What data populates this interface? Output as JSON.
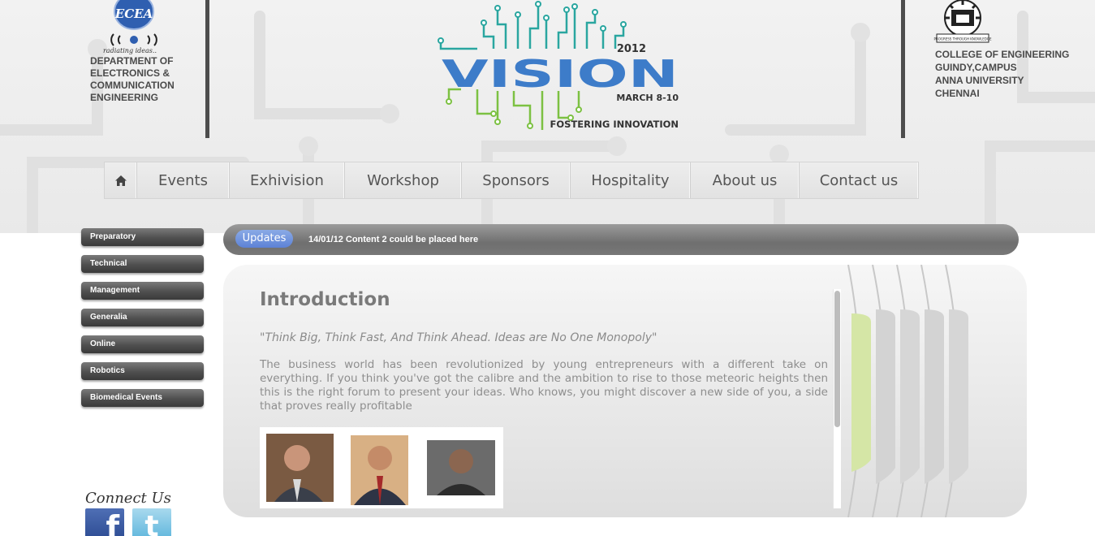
{
  "department": {
    "logo_text": "ECEA",
    "tagline": "radiating ideas..",
    "name_lines": [
      "DEPARTMENT OF",
      "ELECTRONICS &",
      "COMMUNICATION",
      "ENGINEERING"
    ]
  },
  "event_logo": {
    "year": "2012",
    "title": "VISION",
    "dates": "MARCH 8-10",
    "tagline": "FOSTERING INNOVATION"
  },
  "college": {
    "emblem_motto": "PROGRESS THROUGH KNOWLEDGE",
    "name_lines": [
      "COLLEGE OF ENGINEERING",
      "GUINDY,CAMPUS",
      "ANNA UNIVERSITY",
      "CHENNAI"
    ]
  },
  "nav": {
    "home_icon": "home-icon",
    "items": [
      "Events",
      "Exhivision",
      "Workshop",
      "Sponsors",
      "Hospitality",
      "About us",
      "Contact us"
    ]
  },
  "sidebar": {
    "items": [
      "Preparatory",
      "Technical",
      "Management",
      "Generalia",
      "Online",
      "Robotics",
      "Biomedical Events"
    ]
  },
  "updates": {
    "label": "Updates",
    "date": "14/01/12",
    "text": "Content 2 could be placed here"
  },
  "intro": {
    "title": "Introduction",
    "quote": "\"Think Big, Think Fast, And Think Ahead. Ideas are No One Monopoly\"",
    "body": "The business world has been revolutionized by young entrepreneurs with a different take on everything. If you think you've got the calibre and the ambition to rise to those meteoric heights then this is the right forum to present your ideas. Who knows, you might discover a new side of you, a side that proves really profitable"
  },
  "connect": {
    "label": "Connect Us",
    "facebook_icon": "f",
    "twitter_icon": "t"
  },
  "colors": {
    "nav_text": "#555555",
    "updates_pill": "#6b8ddb",
    "vision_blue": "#3d7cc9",
    "circuit_teal": "#2aa6a0",
    "circuit_green": "#7cc142"
  }
}
